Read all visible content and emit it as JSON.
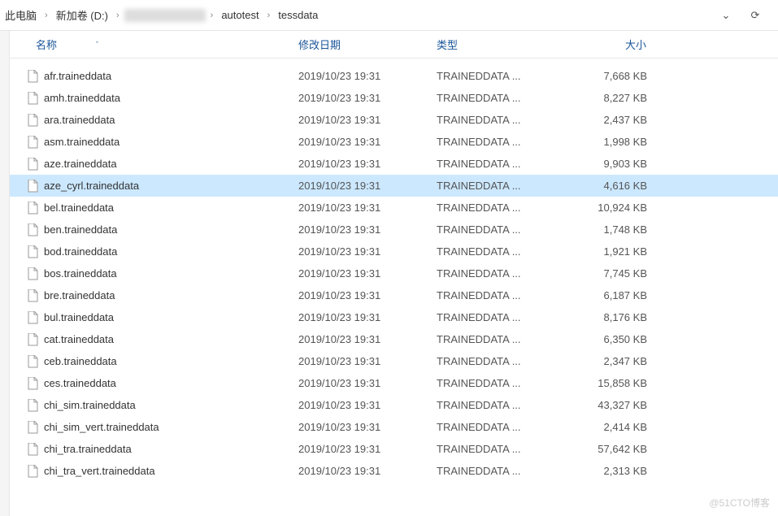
{
  "breadcrumb": {
    "items": [
      {
        "label": "此电脑",
        "blurred": false
      },
      {
        "label": "新加卷 (D:)",
        "blurred": false
      },
      {
        "label": "hidden",
        "blurred": true
      },
      {
        "label": "autotest",
        "blurred": false
      },
      {
        "label": "tessdata",
        "blurred": false
      }
    ],
    "sep": "›"
  },
  "nav": {
    "history_dropdown": "⌄",
    "refresh": "⟳"
  },
  "headers": {
    "name": "名称",
    "date": "修改日期",
    "type": "类型",
    "size": "大小",
    "sort_caret": "ˆ"
  },
  "files": [
    {
      "name": "afr.traineddata",
      "date": "2019/10/23 19:31",
      "type": "TRAINEDDATA ...",
      "size": "7,668 KB",
      "selected": false
    },
    {
      "name": "amh.traineddata",
      "date": "2019/10/23 19:31",
      "type": "TRAINEDDATA ...",
      "size": "8,227 KB",
      "selected": false
    },
    {
      "name": "ara.traineddata",
      "date": "2019/10/23 19:31",
      "type": "TRAINEDDATA ...",
      "size": "2,437 KB",
      "selected": false
    },
    {
      "name": "asm.traineddata",
      "date": "2019/10/23 19:31",
      "type": "TRAINEDDATA ...",
      "size": "1,998 KB",
      "selected": false
    },
    {
      "name": "aze.traineddata",
      "date": "2019/10/23 19:31",
      "type": "TRAINEDDATA ...",
      "size": "9,903 KB",
      "selected": false
    },
    {
      "name": "aze_cyrl.traineddata",
      "date": "2019/10/23 19:31",
      "type": "TRAINEDDATA ...",
      "size": "4,616 KB",
      "selected": true
    },
    {
      "name": "bel.traineddata",
      "date": "2019/10/23 19:31",
      "type": "TRAINEDDATA ...",
      "size": "10,924 KB",
      "selected": false
    },
    {
      "name": "ben.traineddata",
      "date": "2019/10/23 19:31",
      "type": "TRAINEDDATA ...",
      "size": "1,748 KB",
      "selected": false
    },
    {
      "name": "bod.traineddata",
      "date": "2019/10/23 19:31",
      "type": "TRAINEDDATA ...",
      "size": "1,921 KB",
      "selected": false
    },
    {
      "name": "bos.traineddata",
      "date": "2019/10/23 19:31",
      "type": "TRAINEDDATA ...",
      "size": "7,745 KB",
      "selected": false
    },
    {
      "name": "bre.traineddata",
      "date": "2019/10/23 19:31",
      "type": "TRAINEDDATA ...",
      "size": "6,187 KB",
      "selected": false
    },
    {
      "name": "bul.traineddata",
      "date": "2019/10/23 19:31",
      "type": "TRAINEDDATA ...",
      "size": "8,176 KB",
      "selected": false
    },
    {
      "name": "cat.traineddata",
      "date": "2019/10/23 19:31",
      "type": "TRAINEDDATA ...",
      "size": "6,350 KB",
      "selected": false
    },
    {
      "name": "ceb.traineddata",
      "date": "2019/10/23 19:31",
      "type": "TRAINEDDATA ...",
      "size": "2,347 KB",
      "selected": false
    },
    {
      "name": "ces.traineddata",
      "date": "2019/10/23 19:31",
      "type": "TRAINEDDATA ...",
      "size": "15,858 KB",
      "selected": false
    },
    {
      "name": "chi_sim.traineddata",
      "date": "2019/10/23 19:31",
      "type": "TRAINEDDATA ...",
      "size": "43,327 KB",
      "selected": false
    },
    {
      "name": "chi_sim_vert.traineddata",
      "date": "2019/10/23 19:31",
      "type": "TRAINEDDATA ...",
      "size": "2,414 KB",
      "selected": false
    },
    {
      "name": "chi_tra.traineddata",
      "date": "2019/10/23 19:31",
      "type": "TRAINEDDATA ...",
      "size": "57,642 KB",
      "selected": false
    },
    {
      "name": "chi_tra_vert.traineddata",
      "date": "2019/10/23 19:31",
      "type": "TRAINEDDATA ...",
      "size": "2,313 KB",
      "selected": false
    }
  ],
  "watermark": "@51CTO博客"
}
